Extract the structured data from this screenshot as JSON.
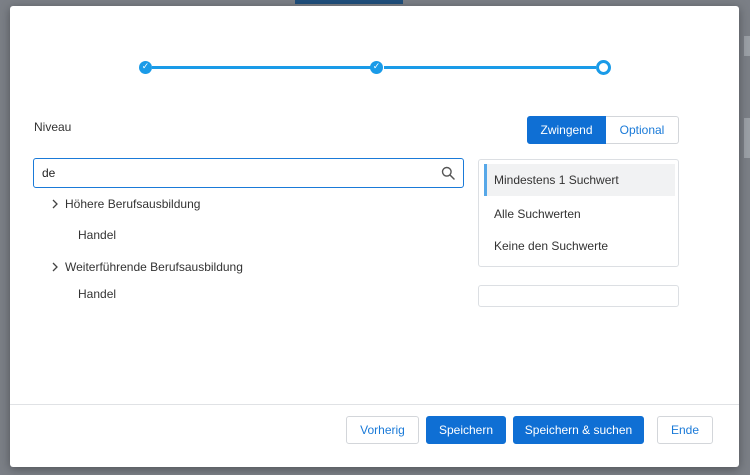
{
  "stepper": {
    "completed_mark": "✓"
  },
  "niveau": {
    "label": "Niveau",
    "toggle": {
      "active": "Zwingend",
      "inactive": "Optional"
    }
  },
  "search": {
    "value": "de",
    "placeholder": ""
  },
  "tree": [
    {
      "label": "Höhere Berufsausbildung",
      "children": [
        "Handel"
      ]
    },
    {
      "label": "Weiterführende Berufsausbildung",
      "children": [
        "Handel"
      ]
    }
  ],
  "match_options": [
    {
      "label": "Mindestens 1 Suchwert",
      "selected": true
    },
    {
      "label": "Alle Suchwerten",
      "selected": false
    },
    {
      "label": "Keine den Suchwerte",
      "selected": false
    }
  ],
  "footer": {
    "previous": "Vorherig",
    "save": "Speichern",
    "save_search": "Speichern & suchen",
    "end": "Ende"
  },
  "colors": {
    "primary": "#0f6fd4",
    "stepper": "#1a9be8",
    "overlay": "#7b7f86"
  }
}
